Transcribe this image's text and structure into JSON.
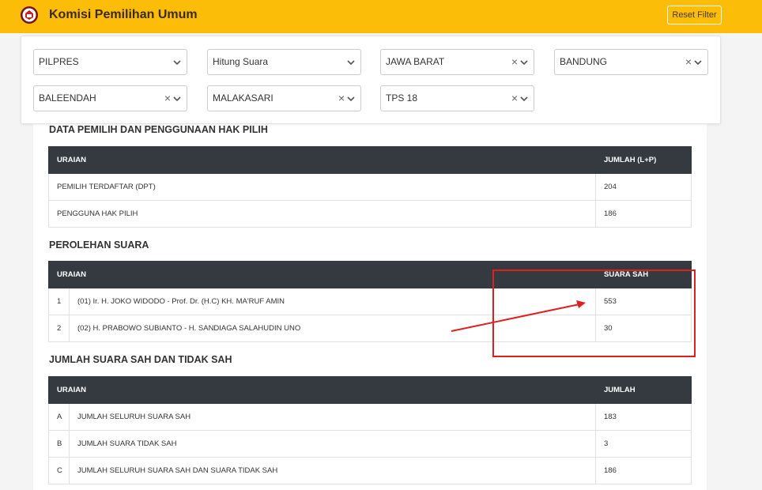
{
  "header": {
    "title": "Komisi Pemilihan Umum",
    "reset_label": "Reset Filter"
  },
  "filters": [
    {
      "value": "PILPRES",
      "clearable": false
    },
    {
      "value": "Hitung Suara",
      "clearable": false
    },
    {
      "value": "JAWA BARAT",
      "clearable": true
    },
    {
      "value": "BANDUNG",
      "clearable": true
    },
    {
      "value": "BALEENDAH",
      "clearable": true
    },
    {
      "value": "MALAKASARI",
      "clearable": true
    },
    {
      "value": "TPS 18",
      "clearable": true
    }
  ],
  "icons": {
    "clear": "×",
    "chevron": "chevron-down-icon"
  },
  "sections": {
    "pemilih": {
      "title": "DATA PEMILIH DAN PENGGUNAAN HAK PILIH",
      "col_label": "URAIAN",
      "col_value": "JUMLAH (L+P)",
      "rows": [
        {
          "label": "PEMILIH TERDAFTAR (DPT)",
          "value": "204"
        },
        {
          "label": "PENGGUNA HAK PILIH",
          "value": "186"
        }
      ]
    },
    "perolehan": {
      "title": "PEROLEHAN SUARA",
      "col_label": "URAIAN",
      "col_value": "SUARA SAH",
      "rows": [
        {
          "idx": "1",
          "label": "(01) Ir. H. JOKO WIDODO - Prof. Dr. (H.C) KH. MA'RUF AMIN",
          "value": "553"
        },
        {
          "idx": "2",
          "label": "(02) H. PRABOWO SUBIANTO - H. SANDIAGA SALAHUDIN UNO",
          "value": "30"
        }
      ]
    },
    "jumlah": {
      "title": "JUMLAH SUARA SAH DAN TIDAK SAH",
      "col_label": "URAIAN",
      "col_value": "JUMLAH",
      "rows": [
        {
          "idx": "A",
          "label": "JUMLAH SELURUH SUARA SAH",
          "value": "183"
        },
        {
          "idx": "B",
          "label": "JUMLAH SUARA TIDAK SAH",
          "value": "3"
        },
        {
          "idx": "C",
          "label": "JUMLAH SELURUH SUARA SAH DAN SUARA TIDAK SAH",
          "value": "186"
        }
      ]
    }
  },
  "colors": {
    "brand": "#fbbd08",
    "table_header": "#343a40",
    "annotation": "#e02020"
  }
}
